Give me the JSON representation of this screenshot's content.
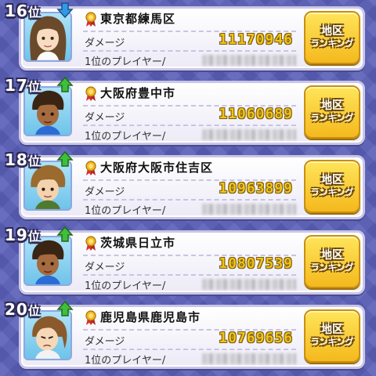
{
  "ranking_list": {
    "damage_label": "ダメージ",
    "top_player_label": "1位のプレイヤー/",
    "region_button_line1": "地区",
    "region_button_line2": "ランキング",
    "rows": [
      {
        "rank": "16",
        "rank_suffix": "位",
        "trend": "down",
        "region": "東京都練馬区",
        "damage": "11170946",
        "avatar": "girl-brown-hair-icon"
      },
      {
        "rank": "17",
        "rank_suffix": "位",
        "trend": "up",
        "region": "大阪府豊中市",
        "damage": "11060689",
        "avatar": "boy-dark-skin-icon"
      },
      {
        "rank": "18",
        "rank_suffix": "位",
        "trend": "up",
        "region": "大阪府大阪市住吉区",
        "damage": "10963899",
        "avatar": "boy-light-brown-hair-icon"
      },
      {
        "rank": "19",
        "rank_suffix": "位",
        "trend": "up",
        "region": "茨城県日立市",
        "damage": "10807539",
        "avatar": "boy-dark-skin-icon"
      },
      {
        "rank": "20",
        "rank_suffix": "位",
        "trend": "up",
        "region": "鹿児島県鹿児島市",
        "damage": "10769656",
        "avatar": "girl-ponytail-icon"
      }
    ]
  },
  "colors": {
    "background": "#5a5fb8",
    "arrow_up": "#3fbf3a",
    "arrow_down": "#2f9be6",
    "damage_value": "#f0c418",
    "button": "#f4b91d"
  }
}
